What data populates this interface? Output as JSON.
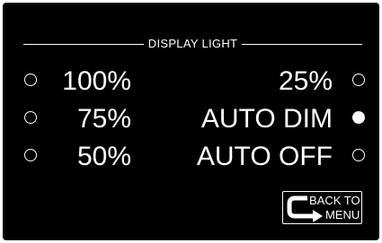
{
  "screen": {
    "title": "DISPLAY LIGHT",
    "options_left": [
      {
        "label": "100%",
        "selected": false
      },
      {
        "label": "75%",
        "selected": false
      },
      {
        "label": "50%",
        "selected": false
      }
    ],
    "options_right": [
      {
        "label": "25%",
        "selected": false
      },
      {
        "label": "AUTO DIM",
        "selected": true
      },
      {
        "label": "AUTO OFF",
        "selected": false
      }
    ],
    "back_button": {
      "line1": "BACK TO",
      "line2": "MENU",
      "icon": "return-arrow-icon"
    }
  },
  "colors": {
    "background": "#000000",
    "foreground": "#ffffff",
    "frame": "#ffffff"
  }
}
